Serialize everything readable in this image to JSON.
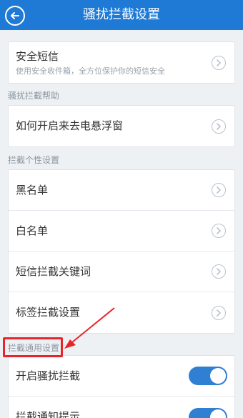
{
  "header": {
    "title": "骚扰拦截设置",
    "bg_color": "#1f7ad6"
  },
  "security_sms": {
    "label": "安全短信",
    "subtitle": "使用安全收件箱，全方位保护你的短信安全"
  },
  "help_section": {
    "title": "骚扰拦截帮助",
    "items": [
      {
        "label": "如何开启来去电悬浮窗"
      }
    ]
  },
  "personal_section": {
    "title": "拦截个性设置",
    "items": [
      {
        "label": "黑名单"
      },
      {
        "label": "白名单"
      },
      {
        "label": "短信拦截关键词"
      },
      {
        "label": "标签拦截设置"
      }
    ]
  },
  "general_section": {
    "title": "拦截通用设置",
    "items": [
      {
        "label": "开启骚扰拦截",
        "toggle_on": true
      },
      {
        "label": "拦截通知提示",
        "toggle_on": true
      }
    ]
  },
  "icons": {
    "back": "back-arrow-icon",
    "row_chevron": "chevron-right-icon"
  },
  "annotation": {
    "color": "#e8242b"
  }
}
